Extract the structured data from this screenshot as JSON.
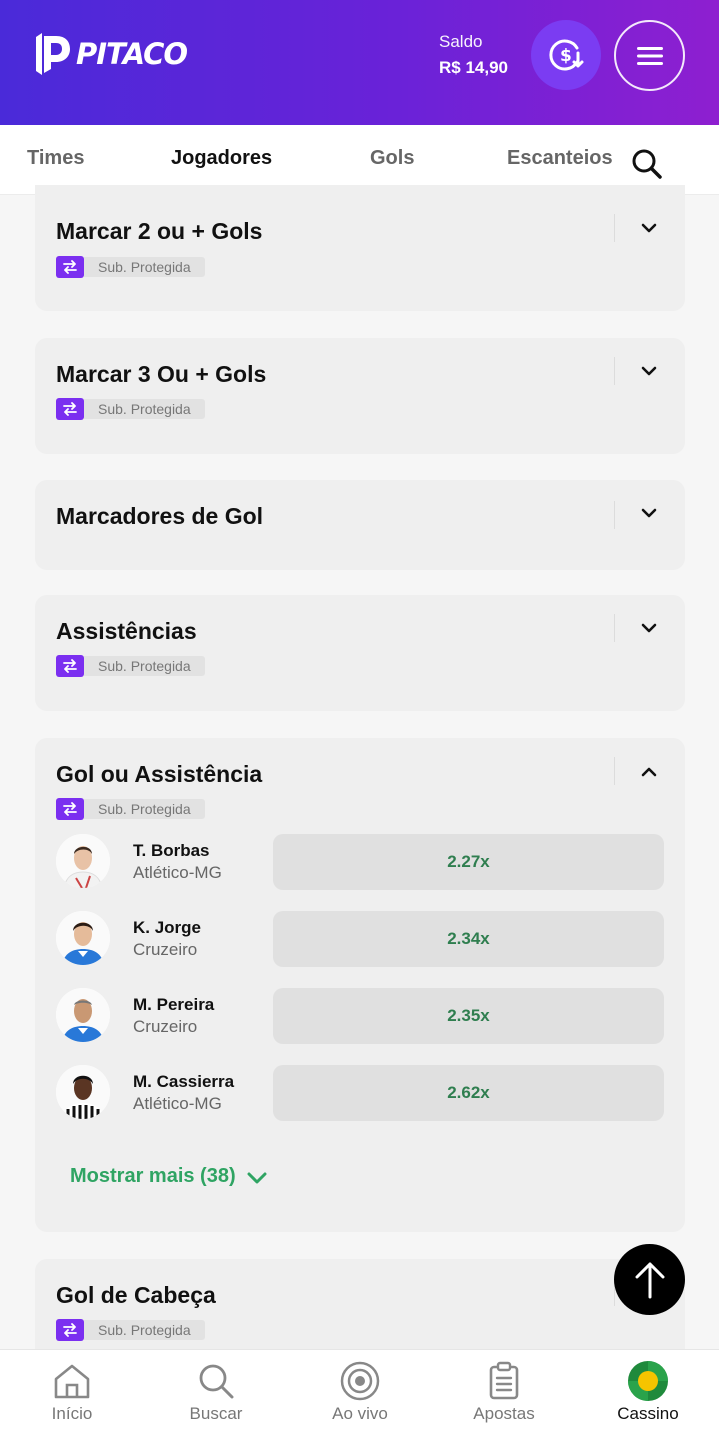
{
  "header": {
    "logo_text": "PITACO",
    "balance_label": "Saldo",
    "balance_value": "R$ 14,90",
    "deposit_icon": "dollar-deposit-icon",
    "menu_icon": "hamburger-icon",
    "colors": {
      "gradient_start": "#4a2ad9",
      "gradient_end": "#8e1fd0"
    }
  },
  "tabs": [
    {
      "label": "Times",
      "active": false
    },
    {
      "label": "Jogadores",
      "active": true
    },
    {
      "label": "Gols",
      "active": false
    },
    {
      "label": "Escanteios",
      "active": false
    }
  ],
  "markets": [
    {
      "title": "Marcar 2 ou + Gols",
      "badge": "Sub. Protegida",
      "expanded": false
    },
    {
      "title": "Marcar 3 Ou + Gols",
      "badge": "Sub. Protegida",
      "expanded": false
    },
    {
      "title": "Marcadores de Gol",
      "badge": "",
      "expanded": false
    },
    {
      "title": "Assistências",
      "badge": "Sub. Protegida",
      "expanded": false
    },
    {
      "title": "Gol ou Assistência",
      "badge": "Sub. Protegida",
      "expanded": true,
      "players": [
        {
          "name": "T. Borbas",
          "team": "Atlético-MG",
          "odd": "2.27x"
        },
        {
          "name": "K. Jorge",
          "team": "Cruzeiro",
          "odd": "2.34x"
        },
        {
          "name": "M. Pereira",
          "team": "Cruzeiro",
          "odd": "2.35x"
        },
        {
          "name": "M. Cassierra",
          "team": "Atlético-MG",
          "odd": "2.62x"
        }
      ],
      "show_more": "Mostrar mais (38)"
    },
    {
      "title": "Gol de Cabeça",
      "badge": "Sub. Protegida",
      "expanded": false
    }
  ],
  "bottom_nav": [
    {
      "label": "Início",
      "icon": "home-icon",
      "active": false
    },
    {
      "label": "Buscar",
      "icon": "search-icon",
      "active": false
    },
    {
      "label": "Ao vivo",
      "icon": "live-icon",
      "active": false
    },
    {
      "label": "Apostas",
      "icon": "clipboard-icon",
      "active": false
    },
    {
      "label": "Cassino",
      "icon": "casino-icon",
      "active": true
    }
  ],
  "accent_color": "#7a22d8",
  "odd_text_color": "#2f7e4f",
  "show_more_color": "#2fa463"
}
